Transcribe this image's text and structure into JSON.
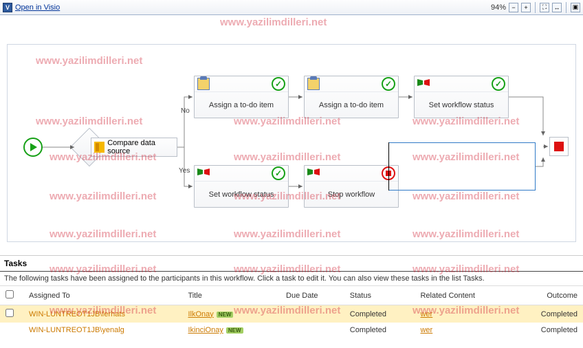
{
  "toolbar": {
    "open": "Open in Visio",
    "zoom": "94%"
  },
  "nodes": {
    "compare": "Compare data source",
    "assign1": "Assign a to-do item",
    "assign2": "Assign a to-do item",
    "setwf1": "Set workflow status",
    "setwf2": "Set workflow status",
    "stop": "Stop workflow"
  },
  "edge": {
    "no": "No",
    "yes": "Yes"
  },
  "tasks": {
    "header": "Tasks",
    "desc": "The following tasks have been assigned to the participants in this workflow. Click a task to edit it. You can also view these tasks in the list Tasks.",
    "cols": {
      "assigned": "Assigned To",
      "title": "Title",
      "due": "Due Date",
      "status": "Status",
      "related": "Related Content",
      "outcome": "Outcome"
    },
    "rows": [
      {
        "assigned": "WIN-LUNTREOT1JB\\ferhats",
        "title": "IlkOnay",
        "status": "Completed",
        "related": "wer",
        "outcome": "Completed"
      },
      {
        "assigned": "WIN-LUNTREOT1JB\\yenalg",
        "title": "IkinciOnay",
        "status": "Completed",
        "related": "wer",
        "outcome": "Completed"
      }
    ],
    "new": "NEW"
  },
  "watermark": "www.yazilimdilleri.net"
}
